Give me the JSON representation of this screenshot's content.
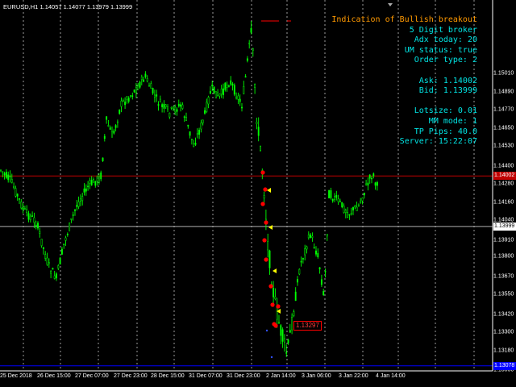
{
  "header": {
    "symbol_timeframe": "EURUSD,H1",
    "ohlc": "1.14057 1.14077 1.13979 1.13999"
  },
  "panel": {
    "title": "Indication of Bullish breakout",
    "lines": [
      "5 Digit broker",
      "Adx today: 20",
      "UM status: true",
      "Order type: 2",
      "",
      "Ask: 1.14002",
      "Bid: 1.13999",
      "",
      "Lotsize: 0.01",
      "MM mode: 1",
      "TP Pips: 40.0",
      "Server: 15:22:07"
    ]
  },
  "price_axis": {
    "labels": [
      "1.15010",
      "1.14890",
      "1.14770",
      "1.14650",
      "1.14530",
      "1.14400",
      "1.14280",
      "1.14160",
      "1.14040",
      "1.13910",
      "1.13800",
      "1.13670",
      "1.13550",
      "1.13420",
      "1.13300",
      "1.13180",
      "1.13050"
    ],
    "ask_tag": "1.14002",
    "bid_tag": "1.13999",
    "low_tag": "1.13078"
  },
  "time_axis": {
    "labels": [
      "25 Dec 2018",
      "26 Dec 15:00",
      "27 Dec 07:00",
      "27 Dec 23:00",
      "28 Dec 15:00",
      "31 Dec 07:00",
      "31 Dec 23:00",
      "2 Jan 14:00",
      "3 Jan 06:00",
      "3 Jan 22:00",
      "4 Jan 14:00"
    ]
  },
  "annotation": {
    "price_label": "1.13297"
  },
  "colors": {
    "background": "#000000",
    "candle": "#00ff00",
    "grid": "#d8d8d8",
    "ask_line": "#c00000",
    "bid_line": "#b0b0b0",
    "low_line": "#0000ff",
    "title": "#ff9900",
    "panel_text": "#00e5e5",
    "arrow": "#ff0000"
  }
}
